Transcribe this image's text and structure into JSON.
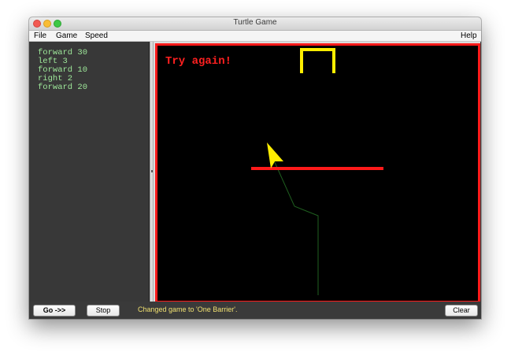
{
  "window": {
    "title": "Turtle Game",
    "controls": [
      "close",
      "minimize",
      "maximize"
    ]
  },
  "menubar": {
    "file": "File",
    "game": "Game",
    "speed": "Speed",
    "help": "Help"
  },
  "editor": {
    "lines": [
      "forward 30",
      "left 3",
      "forward 10",
      "right 2",
      "forward 20"
    ]
  },
  "canvas": {
    "message": "Try again!",
    "colors": {
      "background": "#000000",
      "border": "#ff1a1a",
      "barrier": "#ff1a1a",
      "goal": "#ffee00",
      "turtle": "#ffee00",
      "trail": "#1f5f1f"
    },
    "icons": {
      "goal": "goal-bracket-icon",
      "turtle": "turtle-arrow-icon"
    }
  },
  "toolbar": {
    "go_label": "Go ->>",
    "stop_label": "Stop",
    "clear_label": "Clear",
    "status": "Changed game to 'One Barrier'."
  }
}
